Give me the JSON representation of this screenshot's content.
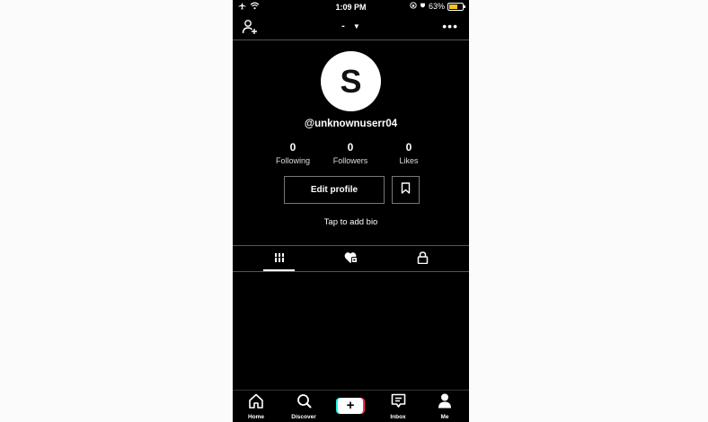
{
  "status_bar": {
    "time": "1:09 PM",
    "battery": "63%",
    "battery_level": 0.63
  },
  "header": {
    "title": "-",
    "more": "•••"
  },
  "profile": {
    "avatar_letter": "S",
    "username": "@unknownuserr04",
    "stats": [
      {
        "value": "0",
        "label": "Following"
      },
      {
        "value": "0",
        "label": "Followers"
      },
      {
        "value": "0",
        "label": "Likes"
      }
    ],
    "edit_label": "Edit profile",
    "bio_prompt": "Tap to add bio"
  },
  "tabs": [
    {
      "icon": "grid-icon",
      "active": true
    },
    {
      "icon": "liked-videos-icon",
      "active": false
    },
    {
      "icon": "lock-icon",
      "active": false
    }
  ],
  "bottom_nav": [
    {
      "label": "Home",
      "icon": "home-icon"
    },
    {
      "label": "Discover",
      "icon": "search-icon"
    },
    {
      "label": "",
      "icon": "plus-icon"
    },
    {
      "label": "Inbox",
      "icon": "inbox-icon"
    },
    {
      "label": "Me",
      "icon": "person-icon"
    }
  ],
  "colors": {
    "background": "#000000",
    "accent_cyan": "#25f4ee",
    "accent_red": "#fe2c55",
    "battery": "#f5c518"
  }
}
